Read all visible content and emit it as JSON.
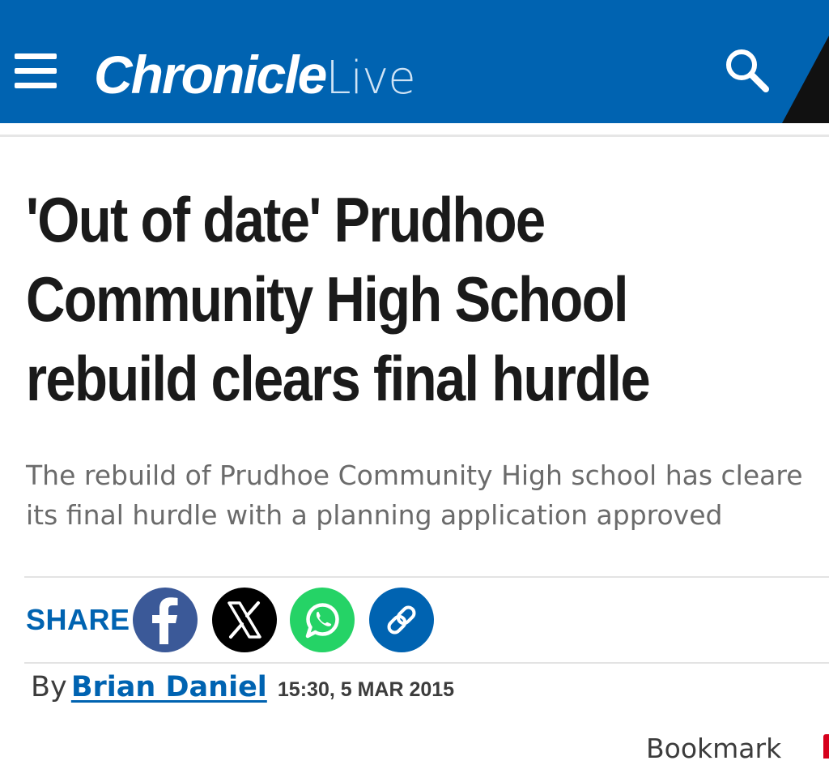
{
  "header": {
    "logo_bold": "Chronicle",
    "logo_light": "Live",
    "brand_color": "#0063b1",
    "menu_icon": "hamburger-menu-icon",
    "search_icon": "search-icon"
  },
  "article": {
    "headline_lines": [
      "'Out of date' Prudhoe",
      "Community High School",
      "rebuild clears final hurdle"
    ],
    "standfirst_lines": [
      "The rebuild of Prudhoe Community High school has cleare",
      "its final hurdle with a planning application approved"
    ]
  },
  "share": {
    "label": "SHARE",
    "buttons": [
      {
        "icon": "facebook-icon",
        "color": "#3b5998"
      },
      {
        "icon": "x-icon",
        "color": "#000000"
      },
      {
        "icon": "whatsapp-icon",
        "color": "#25d366"
      },
      {
        "icon": "link-icon",
        "color": "#0063b1"
      }
    ]
  },
  "byline": {
    "prefix": "By",
    "author": "Brian Daniel",
    "timestamp": "15:30, 5 MAR 2015"
  },
  "bookmark": {
    "label": "Bookmark"
  }
}
